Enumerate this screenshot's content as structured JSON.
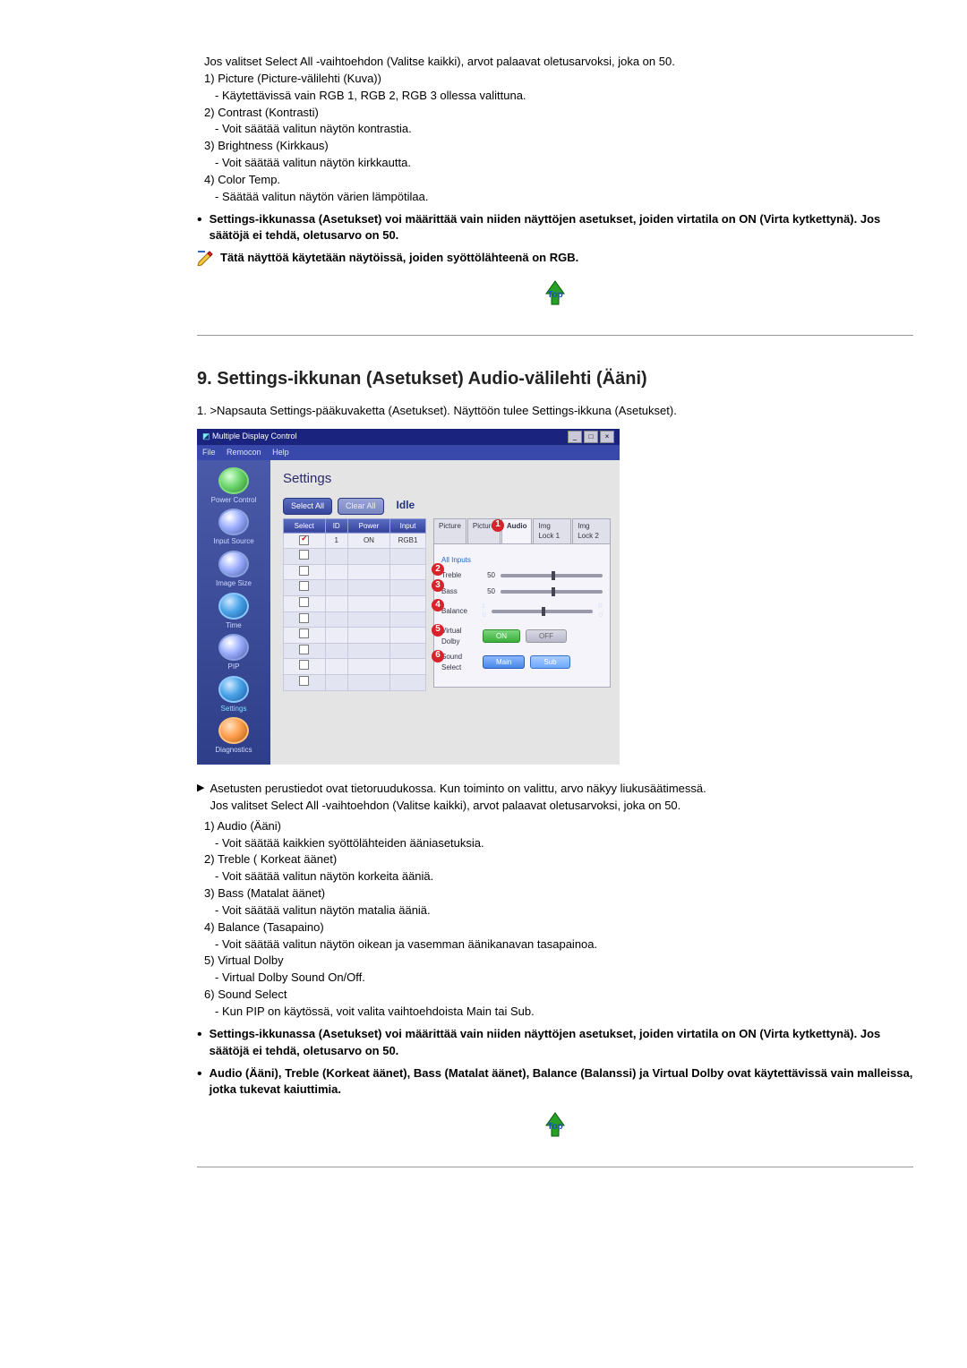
{
  "sectionA": {
    "intro_cont": "Jos valitset Select All -vaihtoehdon (Valitse kaikki), arvot palaavat oletusarvoksi, joka on 50.",
    "items": [
      {
        "n": "1)",
        "title": "Picture (Picture-välilehti (Kuva))",
        "desc": "- Käytettävissä vain RGB 1, RGB 2, RGB 3 ollessa valittuna."
      },
      {
        "n": "2)",
        "title": "Contrast (Kontrasti)",
        "desc": "- Voit säätää valitun näytön kontrastia."
      },
      {
        "n": "3)",
        "title": "Brightness (Kirkkaus)",
        "desc": "- Voit säätää valitun näytön kirkkautta."
      },
      {
        "n": "4)",
        "title": "Color Temp.",
        "desc": "- Säätää valitun näytön värien lämpötilaa."
      }
    ],
    "bullet": "Settings-ikkunassa (Asetukset) voi määrittää vain niiden näyttöjen asetukset, joiden virtatila on ON (Virta kytkettynä). Jos säätöjä ei tehdä, oletusarvo on 50.",
    "iconnote": "Tätä näyttöä käytetään näytöissä, joiden syöttölähteenä on RGB.",
    "top_label": "Top"
  },
  "sectionB": {
    "heading": "9. Settings-ikkunan (Asetukset) Audio-välilehti (Ääni)",
    "step1": "1.  >Napsauta Settings-pääkuvaketta (Asetukset). Näyttöön tulee Settings-ikkuna (Asetukset).",
    "arrow_text1": "Asetusten perustiedot ovat tietoruudukossa. Kun toiminto on valittu, arvo näkyy liukusäätimessä.",
    "arrow_text2": "Jos valitset Select All -vaihtoehdon (Valitse kaikki), arvot palaavat oletusarvoksi, joka on 50.",
    "items": [
      {
        "n": "1)",
        "title": "Audio (Ääni)",
        "desc": "- Voit säätää kaikkien syöttölähteiden ääniasetuksia."
      },
      {
        "n": "2)",
        "title": "Treble ( Korkeat äänet)",
        "desc": "- Voit säätää valitun näytön korkeita ääniä."
      },
      {
        "n": "3)",
        "title": "Bass (Matalat äänet)",
        "desc": "- Voit säätää valitun näytön matalia ääniä."
      },
      {
        "n": "4)",
        "title": "Balance (Tasapaino)",
        "desc": "- Voit säätää valitun näytön oikean ja vasemman äänikanavan tasapainoa."
      },
      {
        "n": "5)",
        "title": "Virtual Dolby",
        "desc": "- Virtual Dolby Sound On/Off."
      },
      {
        "n": "6)",
        "title": "Sound Select",
        "desc": "- Kun PIP on käytössä, voit valita vaihtoehdoista Main tai Sub."
      }
    ],
    "bullet1": "Settings-ikkunassa (Asetukset) voi määrittää vain niiden näyttöjen asetukset, joiden virtatila on ON (Virta kytkettynä). Jos säätöjä ei tehdä, oletusarvo on 50.",
    "bullet2": "Audio (Ääni), Treble (Korkeat äänet), Bass (Matalat äänet), Balance (Balanssi) ja Virtual Dolby ovat käytettävissä vain malleissa, jotka tukevat kaiuttimia.",
    "top_label": "Top"
  },
  "app": {
    "title": "Multiple Display Control",
    "menus": {
      "file": "File",
      "remocon": "Remocon",
      "help": "Help"
    },
    "sidebar": [
      {
        "label": "Power Control"
      },
      {
        "label": "Input Source"
      },
      {
        "label": "Image Size"
      },
      {
        "label": "Time"
      },
      {
        "label": "PIP"
      },
      {
        "label": "Settings",
        "active": true
      },
      {
        "label": "Diagnostics"
      }
    ],
    "settings_heading": "Settings",
    "select_all": "Select All",
    "clear_all": "Clear All",
    "status": "Idle",
    "grid": {
      "headers": {
        "select": "Select",
        "id": "ID",
        "power": "Power",
        "input": "Input"
      },
      "rows": [
        {
          "checked": true,
          "id": "1",
          "power": "ON",
          "input": "RGB1"
        },
        {
          "checked": false
        },
        {
          "checked": false
        },
        {
          "checked": false
        },
        {
          "checked": false
        },
        {
          "checked": false
        },
        {
          "checked": false
        },
        {
          "checked": false
        },
        {
          "checked": false
        },
        {
          "checked": false
        }
      ]
    },
    "tabs": {
      "picture1": "Picture",
      "picture2": "Picture",
      "audio": "Audio",
      "imglock1": "Img Lock 1",
      "imglock2": "Img Lock 2"
    },
    "panel": {
      "allinputs": "All Inputs",
      "treble": {
        "label": "Treble",
        "value": "50"
      },
      "bass": {
        "label": "Bass",
        "value": "50"
      },
      "balance": {
        "label": "Balance",
        "left": "L\n0",
        "right": "R\n0"
      },
      "vdolby": {
        "label": "Virtual\nDolby",
        "on": "ON",
        "off": "OFF"
      },
      "ssel": {
        "label": "Sound\nSelect",
        "main": "Main",
        "sub": "Sub"
      }
    },
    "callouts": [
      "1",
      "2",
      "3",
      "4",
      "5",
      "6"
    ]
  }
}
